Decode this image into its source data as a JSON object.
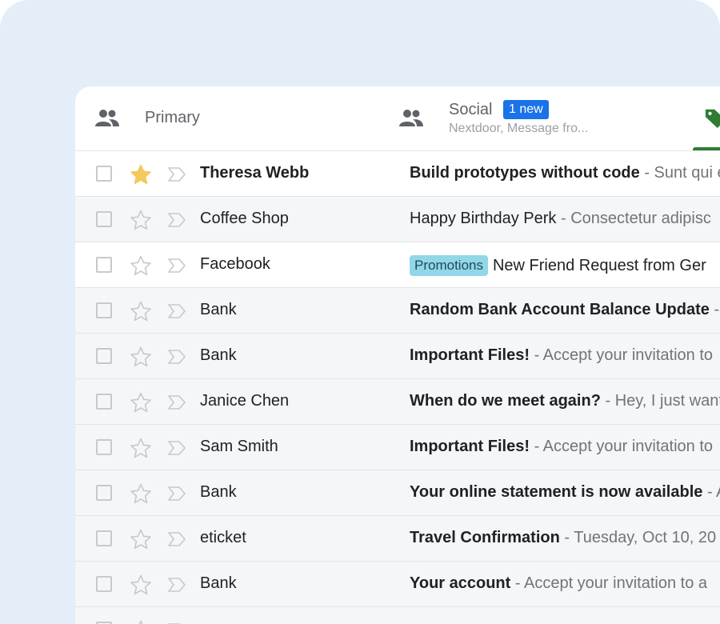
{
  "tabs": {
    "primary": {
      "label": "Primary",
      "icon": "people-icon"
    },
    "social": {
      "label": "Social",
      "badge": "1 new",
      "subtitle": "Nextdoor, Message fro...",
      "icon": "people-icon"
    },
    "promotions": {
      "icon": "tag-icon",
      "accent": "#2e7d32"
    }
  },
  "colors": {
    "badge": "#1a73e8",
    "star_filled": "#f4c95d",
    "label_pill": "#92d7e8",
    "backdrop": "#e3eef8"
  },
  "emails": [
    {
      "sender": "Theresa Webb",
      "subject": "Build prototypes without code",
      "snippet": " - Sunt qui e",
      "starred": true,
      "unread": true,
      "label": ""
    },
    {
      "sender": "Coffee Shop",
      "subject": "Happy Birthday Perk",
      "snippet": " - Consectetur adipisc",
      "starred": false,
      "unread": false,
      "label": ""
    },
    {
      "sender": "Facebook",
      "subject": "New Friend Request from Ger",
      "snippet": "",
      "starred": false,
      "unread": false,
      "label": "Promotions"
    },
    {
      "sender": "Bank",
      "subject": "Random Bank Account Balance Update",
      "snippet": " - ",
      "starred": false,
      "unread": true,
      "label": ""
    },
    {
      "sender": "Bank",
      "subject": "Important Files!",
      "snippet": " - Accept your invitation to",
      "starred": false,
      "unread": true,
      "label": ""
    },
    {
      "sender": "Janice Chen",
      "subject": "When do we meet again?",
      "snippet": " - Hey, I just want",
      "starred": false,
      "unread": true,
      "label": ""
    },
    {
      "sender": "Sam Smith",
      "subject": "Important Files!",
      "snippet": " - Accept your invitation to",
      "starred": false,
      "unread": true,
      "label": ""
    },
    {
      "sender": "Bank",
      "subject": "Your online statement is now available",
      "snippet": " - A",
      "starred": false,
      "unread": true,
      "label": ""
    },
    {
      "sender": "eticket",
      "subject": "Travel Confirmation",
      "snippet": " - Tuesday, Oct 10, 20",
      "starred": false,
      "unread": true,
      "label": ""
    },
    {
      "sender": "Bank",
      "subject": "Your account",
      "snippet": " - Accept your invitation to a",
      "starred": false,
      "unread": true,
      "label": ""
    },
    {
      "sender": "",
      "subject": "",
      "snippet": "",
      "starred": false,
      "unread": true,
      "label": ""
    }
  ]
}
